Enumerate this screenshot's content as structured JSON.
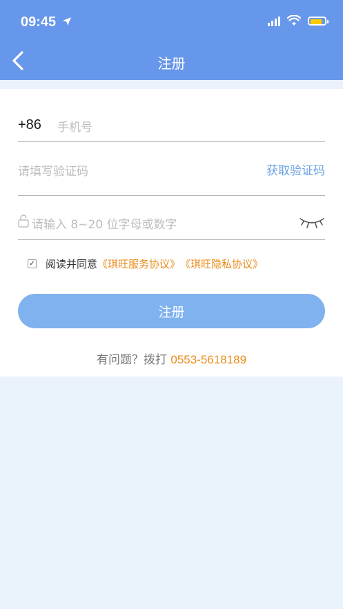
{
  "status_bar": {
    "time": "09:45"
  },
  "nav": {
    "title": "注册"
  },
  "form": {
    "country_code": "+86",
    "phone_placeholder": "手机号",
    "code_placeholder": "请填写验证码",
    "get_code_label": "获取验证码",
    "password_placeholder": "请输入 8~20 位字母或数字",
    "agree_text": "阅读并同意",
    "service_agreement": "《琪旺服务协议》",
    "privacy_agreement": "《琪旺隐私协议》",
    "submit_label": "注册"
  },
  "help": {
    "label": "有问题？拨打",
    "phone": "0553-5618189"
  },
  "colors": {
    "header": "#6797ea",
    "accent_link": "#ea8c1b",
    "button": "#7fb2ee"
  }
}
